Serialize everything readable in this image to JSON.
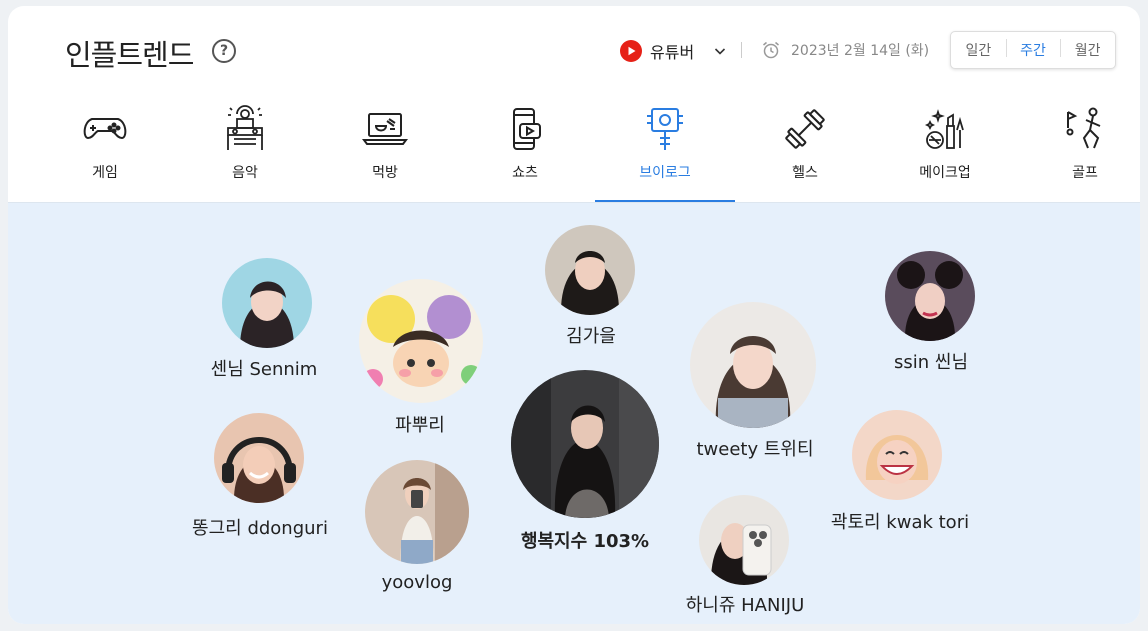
{
  "header": {
    "title": "인플트렌드",
    "help_symbol": "?",
    "platform_label": "유튜버",
    "date": "2023년 2월 14일 (화)",
    "periods": [
      "일간",
      "주간",
      "월간"
    ],
    "active_period": "주간"
  },
  "categories": [
    {
      "label": "게임",
      "icon": "gamepad-icon"
    },
    {
      "label": "음악",
      "icon": "dj-icon"
    },
    {
      "label": "먹방",
      "icon": "laptop-food-icon"
    },
    {
      "label": "쇼츠",
      "icon": "phone-video-icon"
    },
    {
      "label": "브이로그",
      "icon": "selfie-stick-icon",
      "active": true
    },
    {
      "label": "헬스",
      "icon": "dumbbell-icon"
    },
    {
      "label": "메이크업",
      "icon": "makeup-icon"
    },
    {
      "label": "골프",
      "icon": "golf-icon"
    }
  ],
  "bubbles": [
    {
      "name": "센님 Sennim"
    },
    {
      "name": "파뿌리"
    },
    {
      "name": "김가을"
    },
    {
      "name": "tweety 트위티"
    },
    {
      "name": "ssin 씬님"
    },
    {
      "name": "똥그리 ddonguri"
    },
    {
      "name": "yoovlog"
    },
    {
      "name": "행복지수 103%"
    },
    {
      "name": "하니쥬 HANIJU"
    },
    {
      "name": "곽토리 kwak tori"
    }
  ],
  "colors": {
    "accent": "#2a7de1",
    "youtube_red": "#e62117",
    "cloud_bg": "#e6f0fb"
  }
}
